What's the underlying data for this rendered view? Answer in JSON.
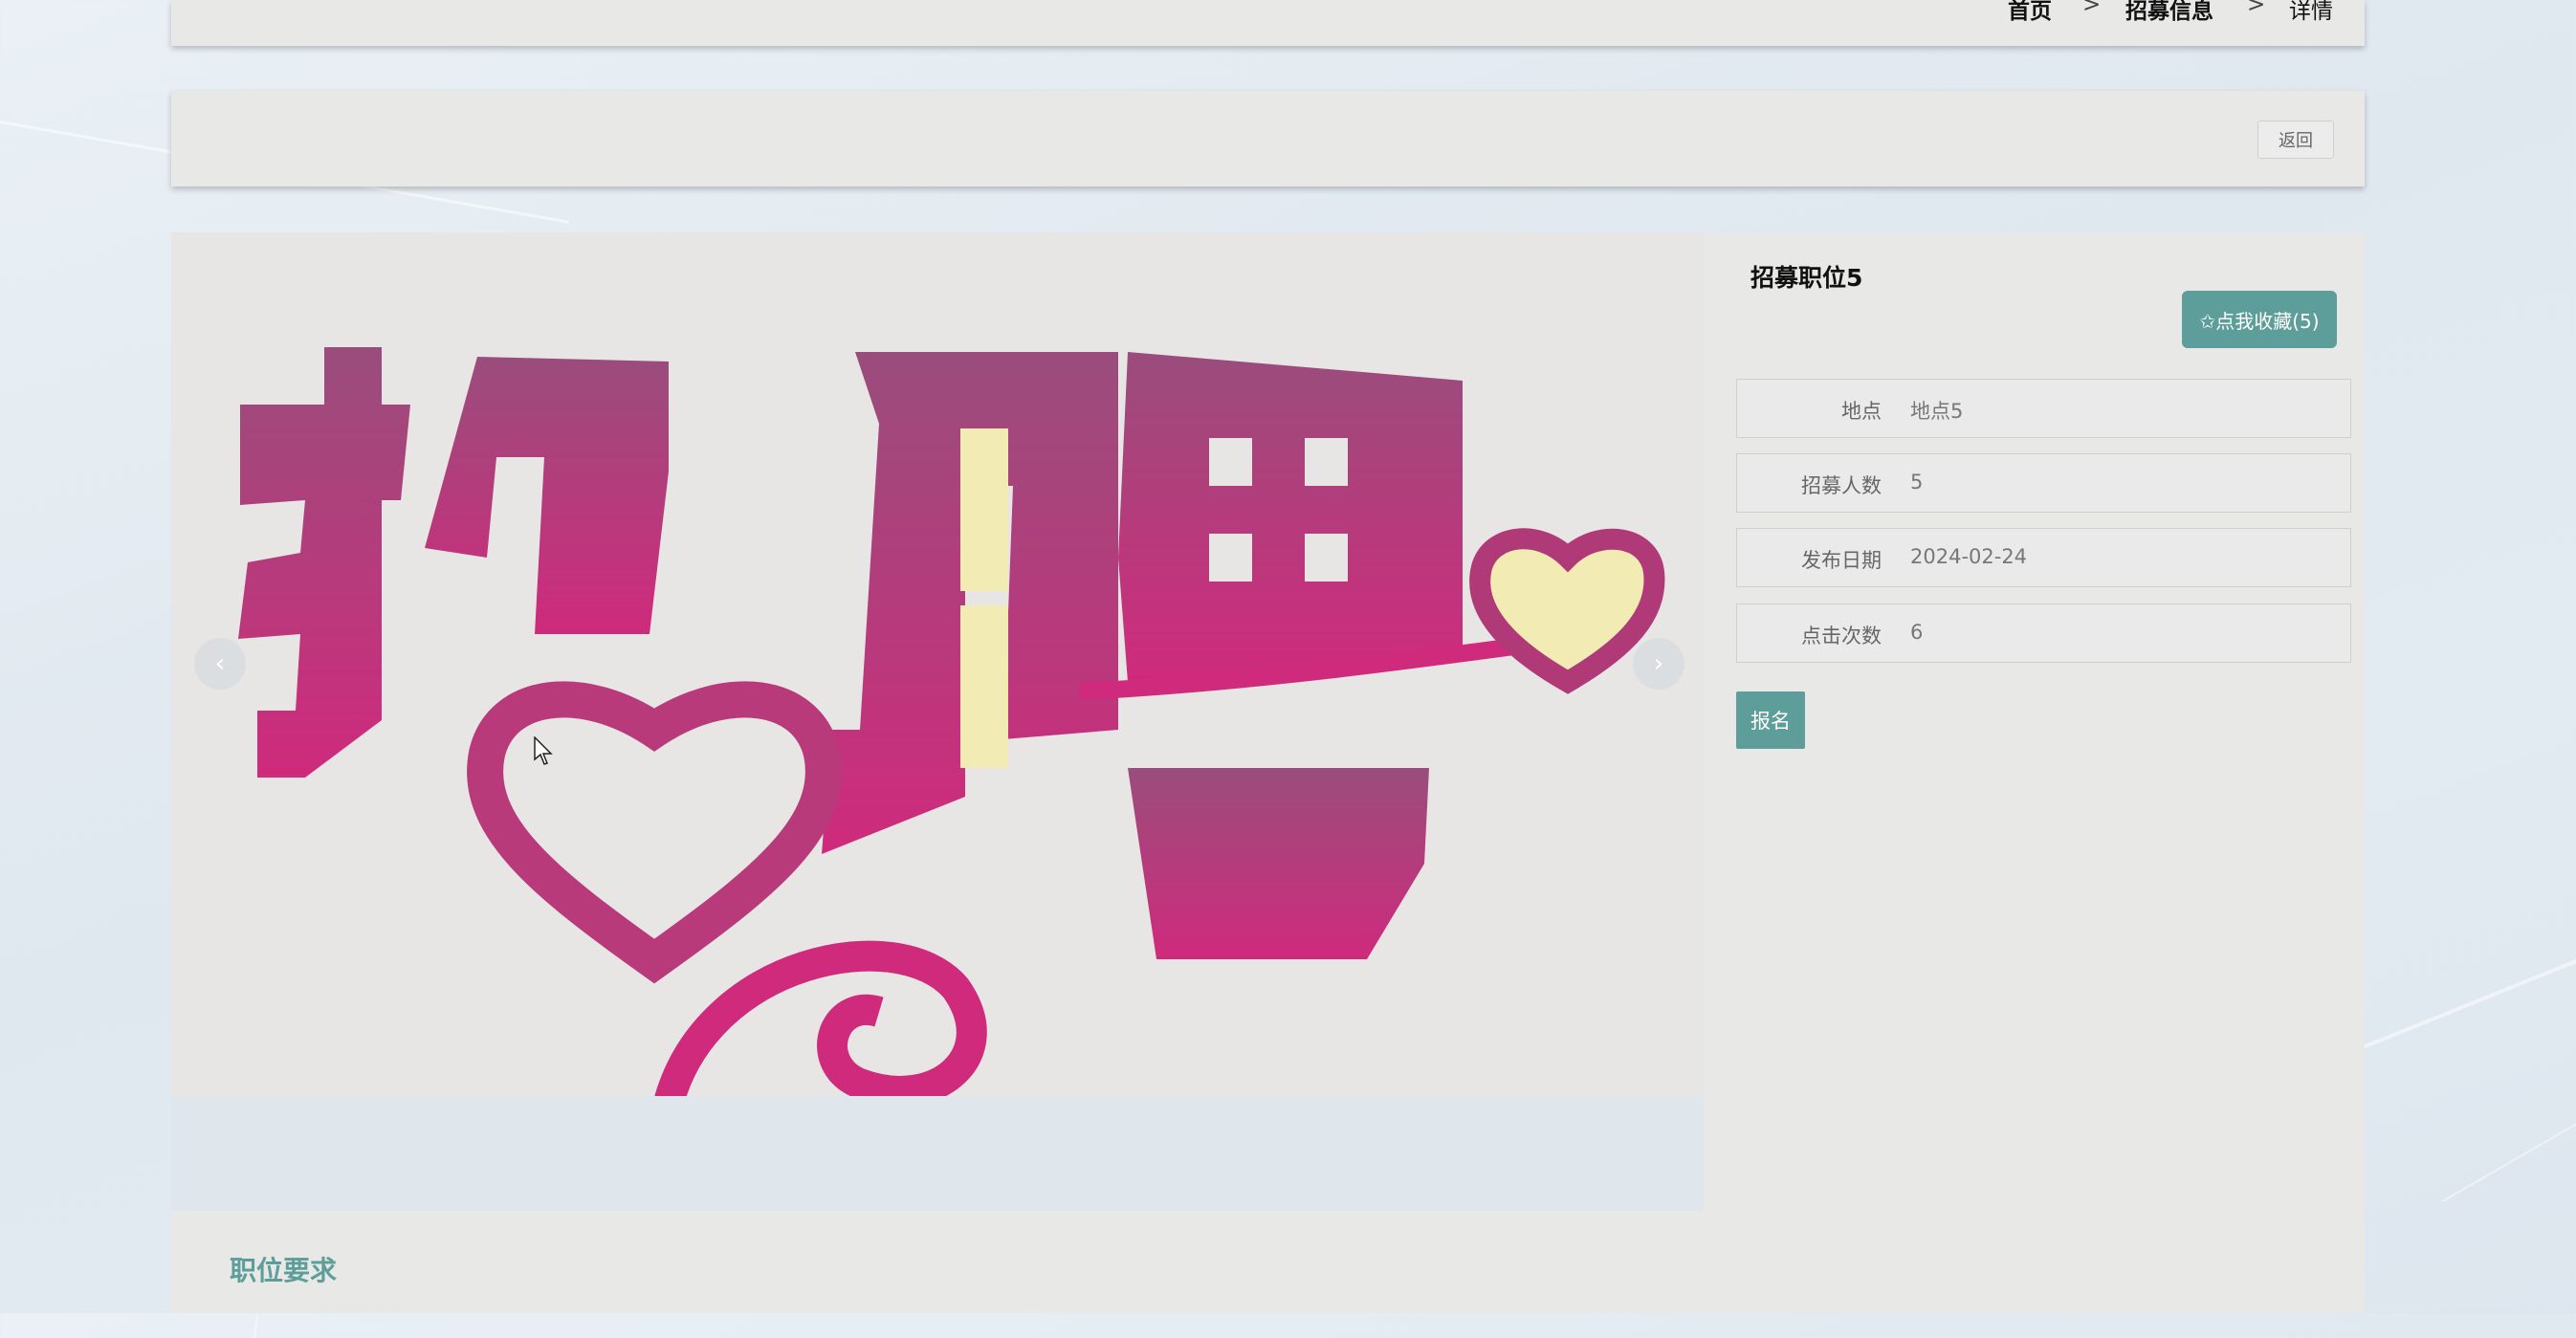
{
  "breadcrumb": {
    "home": "首页",
    "sep": ">",
    "recruit_info": "招募信息",
    "detail": "详情"
  },
  "toolbar": {
    "back_label": "返回"
  },
  "job": {
    "title": "招募职位5",
    "favorite_label": "✩点我收藏(5)",
    "image_alt": "招聘",
    "fields": [
      {
        "label": "地点",
        "value": "地点5"
      },
      {
        "label": "招募人数",
        "value": "5"
      },
      {
        "label": "发布日期",
        "value": "2024-02-24"
      },
      {
        "label": "点击次数",
        "value": "6"
      }
    ],
    "signup_label": "报名"
  },
  "carousel": {
    "prev_icon": "‹",
    "next_icon": "›"
  },
  "requirements": {
    "title": "职位要求"
  },
  "colors": {
    "accent": "#5d9e9a",
    "poster_magenta": "#c8307a",
    "poster_purple": "#9a4d7c",
    "poster_yellow": "#f2ecb4"
  }
}
